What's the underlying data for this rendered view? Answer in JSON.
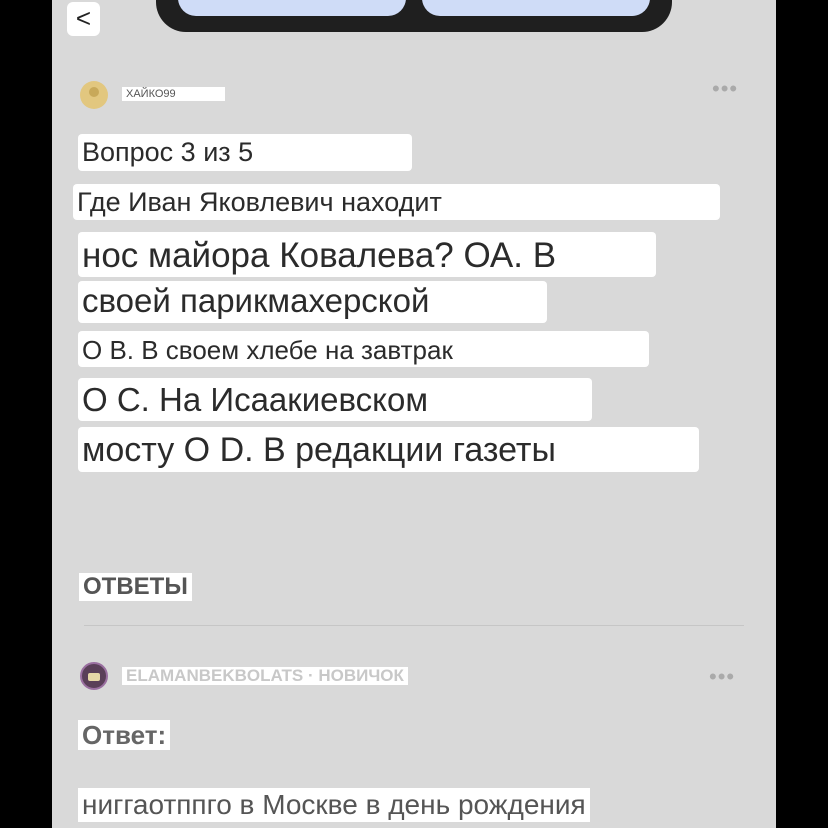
{
  "nav": {
    "back_label": "<"
  },
  "question": {
    "author": "ХАЙКО99",
    "more_label": "•••",
    "lines": [
      "Вопрос 3 из 5",
      "Где Иван Яковлевич находит",
      "нос майора Ковалева? ОА. В",
      "своей парикмахерской",
      "О В. В своем хлебе на завтрак",
      "О С. На Исаакиевском",
      "мосту О D. В редакции газеты"
    ]
  },
  "answers": {
    "title": "ОТВЕТЫ",
    "items": [
      {
        "author": "ELAMANBEKBOLATS · НОВИЧОК",
        "more_label": "•••",
        "label": "Ответ:",
        "text": "ниггаотппго в Москве в день рождения"
      }
    ]
  },
  "colors": {
    "background": "#d9d9d9",
    "highlight": "#ffffff",
    "outer": "#000000"
  }
}
